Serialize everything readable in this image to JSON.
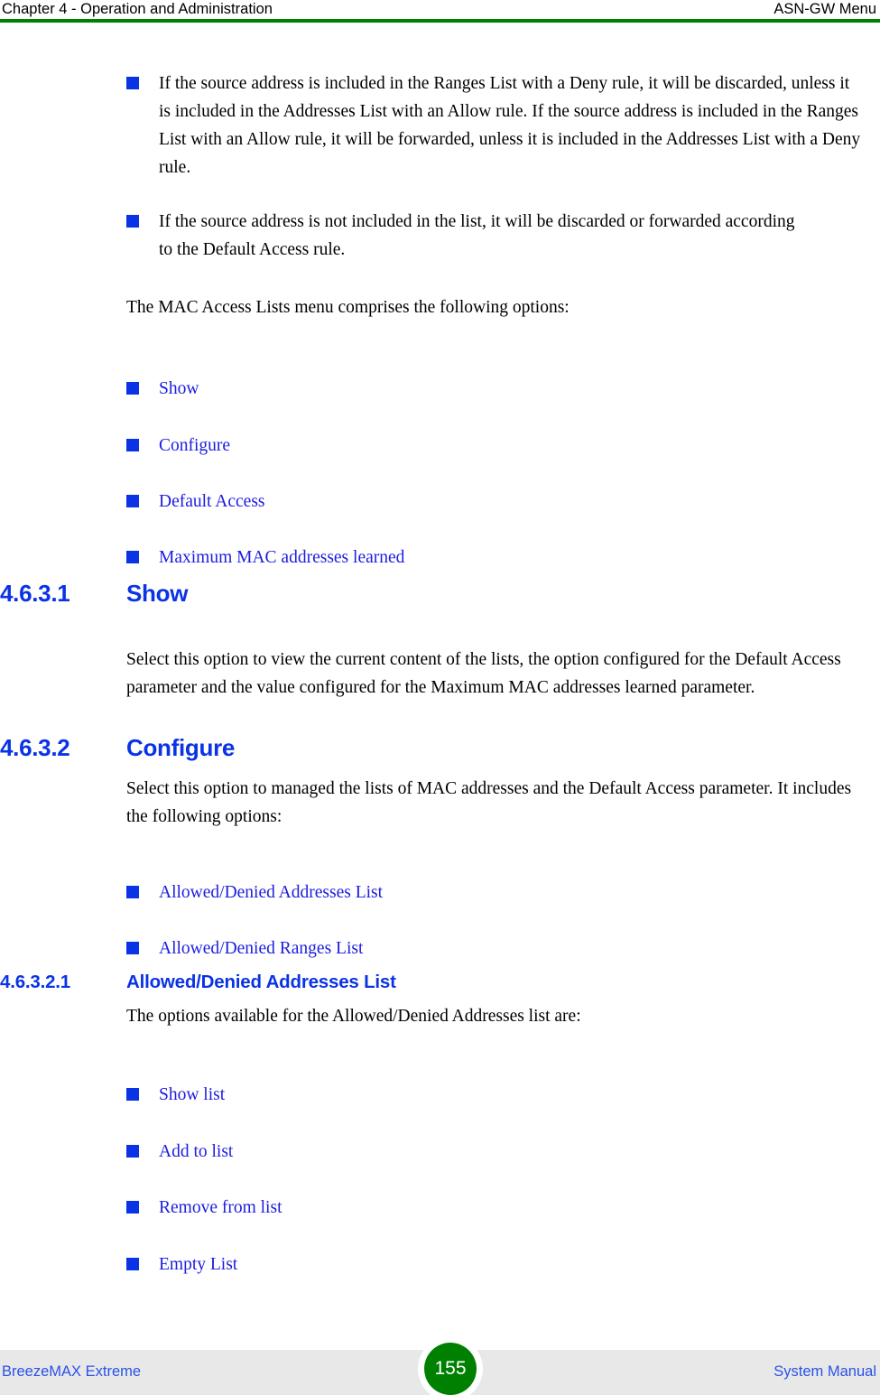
{
  "colors": {
    "heading_blue": "#0a33e5",
    "link_blue": "#1c1ce0",
    "bullet_blue": "#0a33e5",
    "rule_green": "#008000",
    "badge_green": "#008000",
    "footer_band": "#e8e8e8",
    "footer_text_blue": "#2a52e8",
    "body_black": "#000000"
  },
  "header": {
    "left": "Chapter 4 - Operation and Administration",
    "right": "ASN-GW Menu"
  },
  "body": {
    "bullets_top": [
      "If the source address is included in the Ranges List with a Deny rule, it will be discarded, unless it is included in the Addresses List with an Allow rule. If the source address is included in the Ranges List with an Allow rule, it will be forwarded, unless it is included in the Addresses List with a Deny rule.",
      "If the source address is not included in the list, it will be discarded or forwarded according to the Default Access rule."
    ],
    "intro_paragraph": "The MAC Access Lists menu comprises the following options:",
    "menu_options": [
      "Show",
      "Configure",
      "Default Access",
      "Maximum MAC addresses learned"
    ],
    "section_show": {
      "number": "4.6.3.1",
      "title": "Show",
      "paragraph": "Select this option to view the current content of the lists, the option configured for the Default Access parameter and the value configured for the Maximum MAC addresses learned parameter."
    },
    "section_configure": {
      "number": "4.6.3.2",
      "title": "Configure",
      "paragraph": "Select this option to managed the lists of MAC addresses and the Default Access parameter. It includes the following options:",
      "options": [
        "Allowed/Denied Addresses List",
        "Allowed/Denied Ranges List"
      ]
    },
    "section_addresses_list": {
      "number": "4.6.3.2.1",
      "title": "Allowed/Denied Addresses List",
      "paragraph": "The options available for the Allowed/Denied Addresses list are:",
      "options": [
        "Show list",
        "Add to list",
        "Remove from list",
        "Empty List"
      ]
    }
  },
  "footer": {
    "left": "BreezeMAX Extreme",
    "page_number": "155",
    "right": "System Manual"
  }
}
